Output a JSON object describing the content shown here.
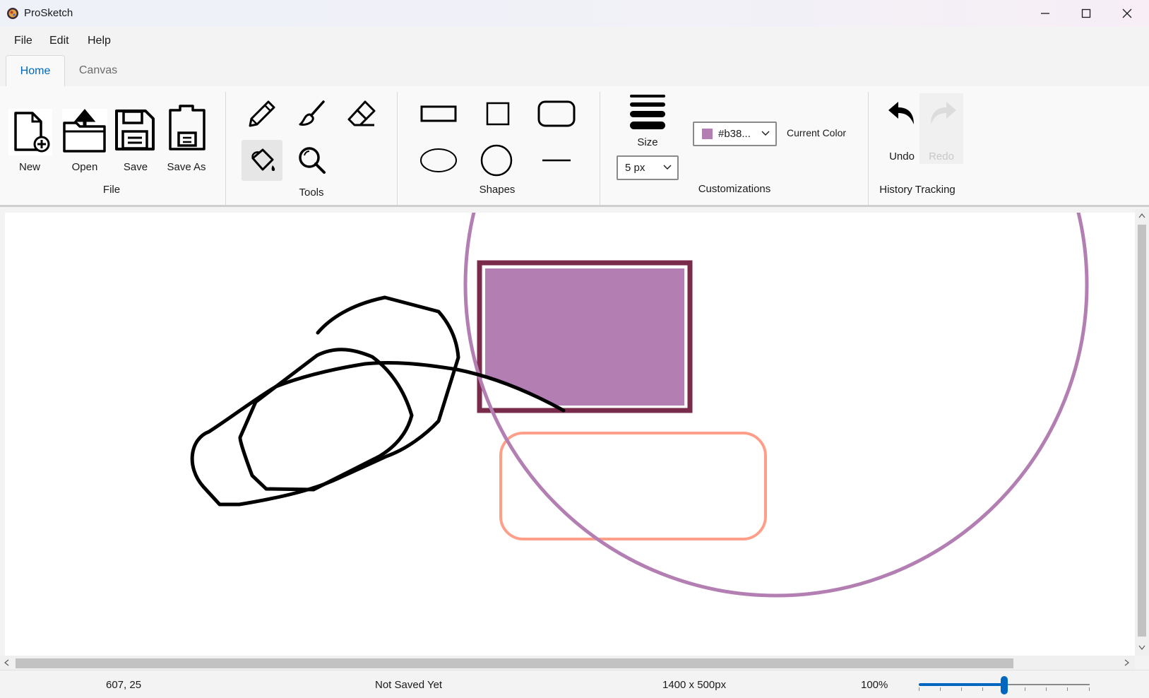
{
  "app": {
    "title": "ProSketch"
  },
  "menu": {
    "file": "File",
    "edit": "Edit",
    "help": "Help"
  },
  "tabs": {
    "home": "Home",
    "canvas": "Canvas"
  },
  "ribbon": {
    "file_group": {
      "label": "File",
      "new": "New",
      "open": "Open",
      "save": "Save",
      "save_as": "Save As"
    },
    "tools_group": {
      "label": "Tools",
      "selected_tool": "fill-bucket"
    },
    "shapes_group": {
      "label": "Shapes"
    },
    "custom_group": {
      "label": "Customizations",
      "size_label": "Size",
      "size_value": "5 px",
      "color_value": "#b38...",
      "color_swatch": "#b37fb3",
      "current_color_label": "Current Color"
    },
    "history_group": {
      "label": "History Tracking",
      "undo": "Undo",
      "redo": "Redo"
    }
  },
  "colors": {
    "accent": "#0067c0",
    "fill_rect": "#b37fb3",
    "rect_border": "#7a2a4a",
    "circle_stroke": "#b37fb3",
    "rounded_rect_stroke": "#ff9f8a",
    "freehand_stroke": "#000000"
  },
  "status": {
    "cursor": "607, 25",
    "save_state": "Not Saved Yet",
    "canvas_size": "1400 x 500px",
    "zoom": "100%",
    "zoom_slider_value": 100
  }
}
